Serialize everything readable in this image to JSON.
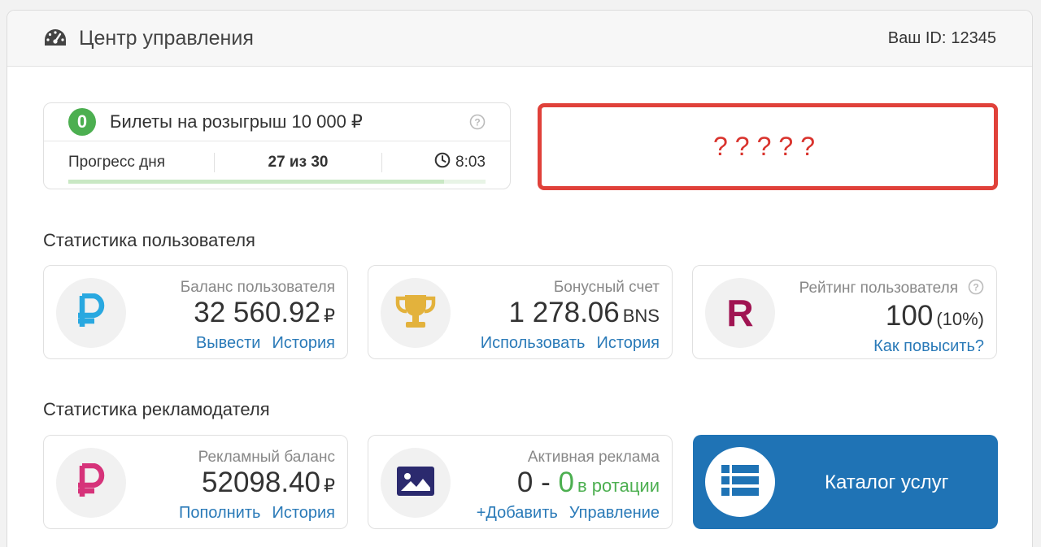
{
  "header": {
    "title": "Центр управления",
    "user_id_label": "Ваш ID:",
    "user_id_value": "12345"
  },
  "tickets": {
    "count": "0",
    "label": "Билеты на розыгрыш 10 000 ₽",
    "progress_label": "Прогресс дня",
    "progress_value": "27 из 30",
    "progress_fraction": 0.9,
    "timer": "8:03"
  },
  "promo": {
    "text": "?????"
  },
  "user_stats": {
    "title": "Статистика пользователя",
    "balance": {
      "label": "Баланс пользователя",
      "amount": "32 560.92",
      "unit": "₽",
      "link1": "Вывести",
      "link2": "История"
    },
    "bonus": {
      "label": "Бонусный счет",
      "amount": "1 278.06",
      "unit": "BNS",
      "link1": "Использовать",
      "link2": "История"
    },
    "rating": {
      "label": "Рейтинг пользователя",
      "amount": "100",
      "unit": "(10%)",
      "link1": "Как повысить?",
      "icon_letter": "R"
    }
  },
  "advertiser_stats": {
    "title": "Статистика рекламодателя",
    "ad_balance": {
      "label": "Рекламный баланс",
      "amount": "52098.40",
      "unit": "₽",
      "link1": "Пополнить",
      "link2": "История"
    },
    "active_ads": {
      "label": "Активная реклама",
      "total": "0",
      "dash": "-",
      "rotating": "0",
      "rotating_label": "в ротации",
      "link1": "+Добавить",
      "link2": "Управление"
    },
    "catalog": {
      "label": "Каталог услуг"
    }
  },
  "colors": {
    "accent_blue": "#1f73b5",
    "link": "#2a7ab8",
    "green": "#4caf50",
    "red": "#e0413a",
    "ruble_blue": "#29a8e0",
    "ruble_pink": "#d6337a",
    "rating": "#a01452",
    "trophy": "#e3b23c",
    "image_icon": "#2b2a6e"
  }
}
